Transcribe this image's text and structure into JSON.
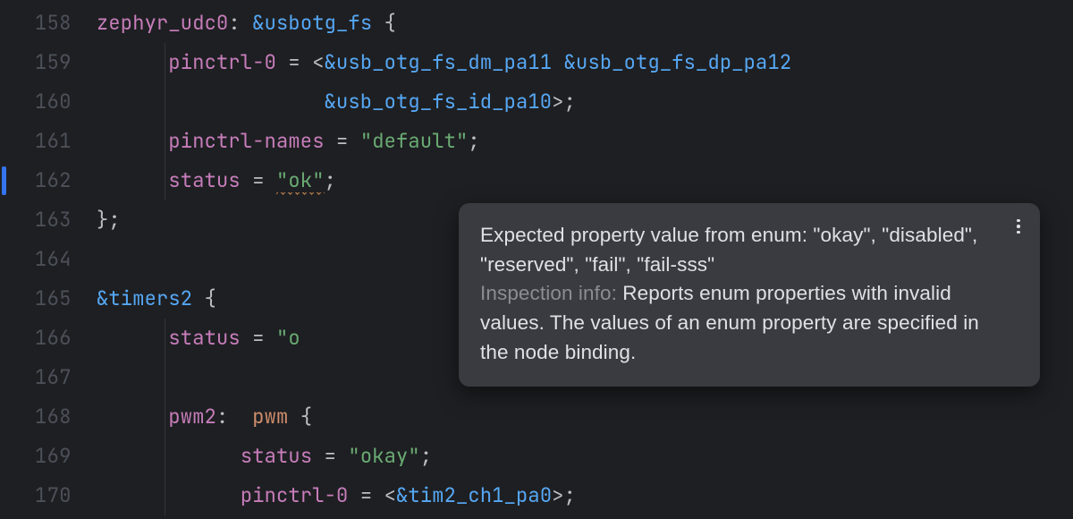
{
  "gutter": {
    "start": 158,
    "count": 13,
    "marked_line": 162
  },
  "code": {
    "l158": {
      "label": "zephyr_udc0",
      "ref": "&usbotg_fs"
    },
    "l159": {
      "prop": "pinctrl-0",
      "ref1": "&usb_otg_fs_dm_pa11",
      "ref2": "&usb_otg_fs_dp_pa12"
    },
    "l160": {
      "ref": "&usb_otg_fs_id_pa10"
    },
    "l161": {
      "prop": "pinctrl-names",
      "val": "\"default\""
    },
    "l162": {
      "prop": "status",
      "val": "\"ok\""
    },
    "l163": {
      "close": "};"
    },
    "l165": {
      "ref": "&timers2"
    },
    "l166": {
      "prop": "status",
      "valpre": "\"o"
    },
    "l168": {
      "label": "pwm2",
      "kw": "pwm"
    },
    "l169": {
      "prop": "status",
      "val": "\"okay\""
    },
    "l170": {
      "prop": "pinctrl-0",
      "ref": "&tim2_ch1_pa0"
    }
  },
  "tooltip": {
    "message": "Expected property value from enum: \"okay\", \"disabled\", \"reserved\", \"fail\", \"fail-sss\"",
    "inspection_label": "Inspection info:",
    "inspection_body": " Reports enum properties with invalid values. The values of an enum property are specified in the node binding."
  }
}
